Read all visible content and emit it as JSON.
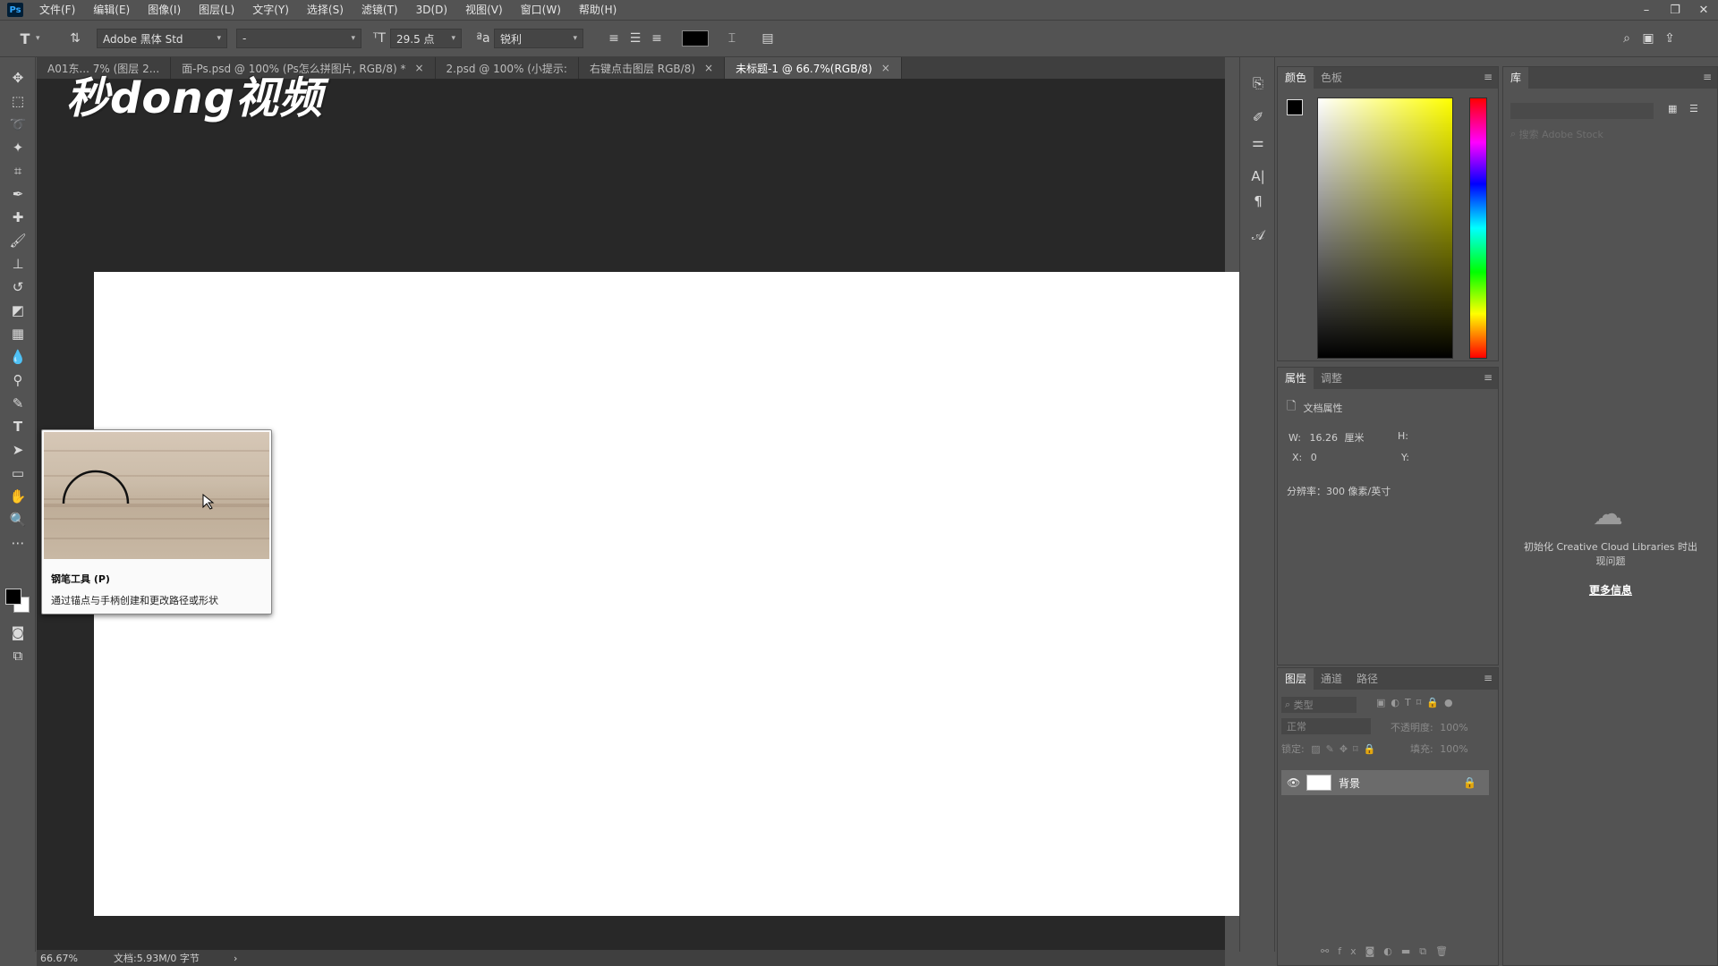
{
  "app": {
    "logo_text": "Ps"
  },
  "menubar": {
    "items": [
      "文件(F)",
      "编辑(E)",
      "图像(I)",
      "图层(L)",
      "文字(Y)",
      "选择(S)",
      "滤镜(T)",
      "3D(D)",
      "视图(V)",
      "窗口(W)",
      "帮助(H)"
    ]
  },
  "options": {
    "tool_icon": "type-tool-icon",
    "font_family": "Adobe 黑体 Std",
    "font_style": "-",
    "font_size": "29.5 点",
    "antialias": "锐利",
    "text_color": "#000000"
  },
  "tabs": [
    {
      "label": "A01东... 7% (图层 2...",
      "active": false,
      "close": ""
    },
    {
      "label": "面-Ps.psd @ 100% (Ps怎么拼图片, RGB/8) *",
      "active": false,
      "close": "×"
    },
    {
      "label": "2.psd @ 100% (小提示:",
      "active": false,
      "close": ""
    },
    {
      "label": "右键点击图层 RGB/8)",
      "active": false,
      "close": "×"
    },
    {
      "label": "未标题-1 @ 66.7%(RGB/8)",
      "active": true,
      "close": "×"
    }
  ],
  "watermark": "秒dong视频",
  "tooltip": {
    "title": "钢笔工具 (P)",
    "description": "通过锚点与手柄创建和更改路径或形状"
  },
  "color_panel": {
    "tabs": [
      "颜色",
      "色板"
    ],
    "fg_color": "#000000",
    "bg_color": "#ffffff"
  },
  "properties_panel": {
    "tabs": [
      "属性",
      "调整"
    ],
    "section": "文档属性",
    "w_label": "W:",
    "w_value": "16.26",
    "w_unit": "厘米",
    "h_label": "H:",
    "x_label": "X:",
    "x_value": "0",
    "y_label": "Y:",
    "resolution": "分辨率：300 像素/英寸"
  },
  "layers_panel": {
    "tabs": [
      "图层",
      "通道",
      "路径"
    ],
    "filter_placeholder": "类型",
    "blend_mode": "正常",
    "opacity_label": "不透明度:",
    "opacity_value": "100%",
    "lock_label": "锁定:",
    "fill_label": "填充:",
    "fill_value": "100%",
    "layer_name": "背景"
  },
  "library_panel": {
    "tab": "库",
    "search_placeholder": "搜索 Adobe Stock",
    "message": "初始化 Creative Cloud Libraries 时出现问题",
    "more_link": "更多信息"
  },
  "status": {
    "zoom": "66.67%",
    "doc_info": "文档:5.93M/0 字节",
    "arrow": "›"
  }
}
